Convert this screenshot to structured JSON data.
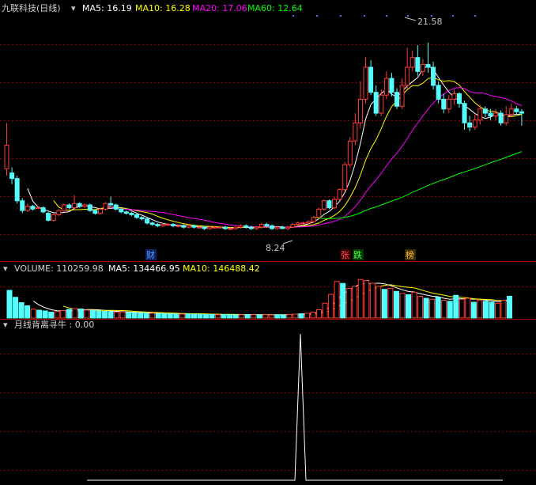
{
  "colors": {
    "background": "#000000",
    "up": "#ff3b3b",
    "down": "#54ffff",
    "ma5": "#ffffff",
    "ma10": "#ffff00",
    "ma20": "#ff00ff",
    "ma60": "#00ff00",
    "grid": "#8a0000",
    "text": "#c8c8c8"
  },
  "header": {
    "title": "九联科技(日线)",
    "ma5_label": "MA5: 16.19",
    "ma10_label": "MA10: 16.28",
    "ma20_label": "MA20: 17.06",
    "ma60_label": "MA60: 12.64"
  },
  "volume_header": {
    "title": "VOLUME: 110259.98",
    "ma5_label": "MA5: 134466.95",
    "ma10_label": "MA10: 146488.42"
  },
  "indicator_header": {
    "title": "月线背离寻牛 : 0.00"
  },
  "markers": {
    "cai": "财",
    "zhang": "张",
    "die": "跌",
    "bang": "榜"
  },
  "chart_data": {
    "type": "candlestick",
    "high_label": "21.58",
    "low_label": "8.24",
    "price_range": [
      7.0,
      23.5
    ],
    "candles": [
      [
        12.5,
        14.2,
        12.0,
        15.8
      ],
      [
        12.2,
        11.8,
        11.4,
        12.6
      ],
      [
        11.8,
        10.2,
        10.0,
        12.0
      ],
      [
        10.2,
        9.5,
        9.3,
        10.4
      ],
      [
        9.5,
        9.8,
        9.4,
        10.0
      ],
      [
        9.8,
        9.6,
        9.5,
        9.9
      ],
      [
        9.7,
        9.7,
        9.6,
        9.8
      ],
      [
        9.7,
        9.4,
        9.3,
        9.8
      ],
      [
        9.3,
        8.8,
        8.7,
        9.4
      ],
      [
        8.8,
        9.2,
        8.7,
        9.3
      ],
      [
        9.2,
        9.5,
        9.1,
        9.6
      ],
      [
        9.5,
        9.9,
        9.4,
        10.0
      ],
      [
        9.9,
        9.7,
        9.6,
        10.0
      ],
      [
        9.7,
        10.0,
        9.6,
        10.6
      ],
      [
        10.0,
        9.8,
        9.7,
        10.1
      ],
      [
        9.8,
        9.9,
        9.7,
        10.0
      ],
      [
        9.9,
        9.5,
        9.4,
        10.0
      ],
      [
        9.5,
        9.3,
        9.2,
        9.6
      ],
      [
        9.3,
        9.6,
        9.2,
        9.7
      ],
      [
        9.6,
        10.0,
        9.5,
        10.1
      ],
      [
        10.0,
        9.9,
        9.8,
        10.5
      ],
      [
        9.9,
        9.6,
        9.5,
        10.0
      ],
      [
        9.6,
        9.4,
        9.3,
        9.7
      ],
      [
        9.4,
        9.3,
        9.2,
        9.5
      ],
      [
        9.3,
        9.2,
        9.1,
        9.4
      ],
      [
        9.2,
        9.0,
        8.9,
        9.3
      ],
      [
        9.0,
        8.9,
        8.8,
        9.1
      ],
      [
        8.9,
        8.6,
        8.5,
        9.0
      ],
      [
        8.6,
        8.5,
        8.4,
        8.7
      ],
      [
        8.5,
        8.4,
        8.3,
        8.6
      ],
      [
        8.4,
        8.5,
        8.3,
        8.6
      ],
      [
        8.5,
        8.5,
        8.4,
        8.6
      ],
      [
        8.5,
        8.4,
        8.3,
        8.6
      ],
      [
        8.4,
        8.4,
        8.3,
        8.5
      ],
      [
        8.4,
        8.3,
        8.2,
        8.5
      ],
      [
        8.3,
        8.4,
        8.2,
        8.5
      ],
      [
        8.4,
        8.3,
        8.2,
        8.5
      ],
      [
        8.3,
        8.3,
        8.2,
        8.4
      ],
      [
        8.3,
        8.2,
        8.1,
        8.4
      ],
      [
        8.2,
        8.3,
        8.1,
        8.4
      ],
      [
        8.3,
        8.3,
        8.2,
        8.4
      ],
      [
        8.3,
        8.3,
        8.2,
        8.4
      ],
      [
        8.3,
        8.2,
        8.1,
        8.4
      ],
      [
        8.2,
        8.2,
        8.1,
        8.3
      ],
      [
        8.2,
        8.3,
        8.1,
        8.4
      ],
      [
        8.3,
        8.4,
        8.2,
        8.5
      ],
      [
        8.4,
        8.3,
        8.2,
        8.5
      ],
      [
        8.3,
        8.2,
        8.1,
        8.4
      ],
      [
        8.2,
        8.3,
        8.1,
        8.4
      ],
      [
        8.3,
        8.5,
        8.2,
        8.6
      ],
      [
        8.5,
        8.4,
        8.3,
        8.6
      ],
      [
        8.4,
        8.2,
        8.1,
        8.5
      ],
      [
        8.2,
        8.3,
        8.1,
        8.4
      ],
      [
        8.3,
        8.2,
        8.2,
        8.4
      ],
      [
        8.2,
        8.3,
        8.1,
        8.4
      ],
      [
        8.3,
        8.5,
        8.24,
        8.6
      ],
      [
        8.5,
        8.6,
        8.4,
        8.7
      ],
      [
        8.6,
        8.6,
        8.4,
        8.7
      ],
      [
        8.6,
        8.7,
        8.5,
        8.8
      ],
      [
        8.7,
        9.0,
        8.6,
        9.1
      ],
      [
        9.0,
        9.6,
        8.9,
        9.7
      ],
      [
        9.6,
        10.2,
        9.5,
        10.3
      ],
      [
        10.2,
        9.7,
        9.6,
        10.3
      ],
      [
        9.7,
        10.3,
        9.6,
        10.5
      ],
      [
        10.3,
        11.0,
        10.2,
        11.1
      ],
      [
        11.0,
        12.8,
        10.9,
        13.0
      ],
      [
        12.8,
        14.5,
        12.6,
        14.8
      ],
      [
        14.5,
        15.8,
        14.2,
        16.5
      ],
      [
        15.8,
        17.5,
        15.4,
        18.8
      ],
      [
        17.5,
        19.8,
        17.2,
        20.5
      ],
      [
        19.8,
        18.0,
        17.8,
        20.3
      ],
      [
        18.0,
        16.5,
        16.3,
        18.5
      ],
      [
        16.5,
        17.8,
        16.3,
        18.2
      ],
      [
        17.8,
        19.0,
        17.5,
        19.5
      ],
      [
        19.0,
        18.0,
        17.7,
        19.4
      ],
      [
        18.0,
        17.0,
        16.8,
        18.3
      ],
      [
        17.0,
        18.5,
        16.8,
        19.0
      ],
      [
        18.5,
        19.8,
        18.2,
        21.2
      ],
      [
        19.8,
        20.5,
        19.5,
        21.0
      ],
      [
        20.5,
        19.5,
        19.2,
        21.4
      ],
      [
        19.5,
        20.0,
        19.2,
        20.4
      ],
      [
        20.0,
        19.8,
        19.4,
        21.58
      ],
      [
        19.8,
        18.5,
        18.2,
        20.2
      ],
      [
        18.5,
        17.5,
        17.2,
        18.8
      ],
      [
        17.5,
        16.8,
        16.5,
        17.9
      ],
      [
        16.8,
        17.5,
        16.5,
        17.8
      ],
      [
        17.5,
        17.9,
        17.1,
        18.2
      ],
      [
        17.9,
        17.2,
        16.9,
        18.0
      ],
      [
        17.2,
        15.8,
        15.3,
        17.4
      ],
      [
        15.8,
        15.5,
        15.2,
        16.3
      ],
      [
        15.5,
        16.0,
        15.3,
        16.4
      ],
      [
        16.0,
        16.8,
        15.7,
        17.1
      ],
      [
        16.8,
        16.5,
        16.2,
        17.0
      ],
      [
        16.5,
        16.3,
        16.0,
        16.8
      ],
      [
        16.3,
        16.5,
        16.0,
        16.8
      ],
      [
        16.5,
        15.8,
        15.6,
        16.7
      ],
      [
        15.8,
        16.4,
        15.6,
        17.0
      ],
      [
        16.4,
        16.8,
        16.2,
        17.2
      ],
      [
        16.8,
        16.6,
        16.4,
        17.0
      ],
      [
        16.6,
        16.5,
        15.6,
        16.8
      ]
    ],
    "volume": [
      [
        140000,
        "down"
      ],
      [
        105000,
        "down"
      ],
      [
        78000,
        "down"
      ],
      [
        62000,
        "down"
      ],
      [
        45000,
        "up"
      ],
      [
        40000,
        "down"
      ],
      [
        36000,
        "down"
      ],
      [
        30000,
        "down"
      ],
      [
        33000,
        "up"
      ],
      [
        38000,
        "up"
      ],
      [
        44000,
        "down"
      ],
      [
        48000,
        "up"
      ],
      [
        46000,
        "down"
      ],
      [
        40000,
        "up"
      ],
      [
        38000,
        "down"
      ],
      [
        36000,
        "down"
      ],
      [
        34000,
        "down"
      ],
      [
        32000,
        "down"
      ],
      [
        30000,
        "up"
      ],
      [
        31000,
        "up"
      ],
      [
        28000,
        "down"
      ],
      [
        26000,
        "down"
      ],
      [
        25000,
        "down"
      ],
      [
        25000,
        "down"
      ],
      [
        24000,
        "up"
      ],
      [
        22000,
        "down"
      ],
      [
        22000,
        "down"
      ],
      [
        21000,
        "down"
      ],
      [
        20000,
        "down"
      ],
      [
        20000,
        "up"
      ],
      [
        21000,
        "down"
      ],
      [
        20000,
        "down"
      ],
      [
        19000,
        "down"
      ],
      [
        18000,
        "down"
      ],
      [
        18000,
        "down"
      ],
      [
        17000,
        "up"
      ],
      [
        18000,
        "down"
      ],
      [
        17000,
        "down"
      ],
      [
        16000,
        "down"
      ],
      [
        17000,
        "up"
      ],
      [
        18000,
        "down"
      ],
      [
        17000,
        "up"
      ],
      [
        16000,
        "down"
      ],
      [
        17000,
        "up"
      ],
      [
        16000,
        "up"
      ],
      [
        17000,
        "down"
      ],
      [
        16000,
        "down"
      ],
      [
        18000,
        "up"
      ],
      [
        20000,
        "up"
      ],
      [
        22000,
        "down"
      ],
      [
        24000,
        "up"
      ],
      [
        30000,
        "up"
      ],
      [
        42000,
        "up"
      ],
      [
        75000,
        "up"
      ],
      [
        120000,
        "up"
      ],
      [
        185000,
        "up"
      ],
      [
        175000,
        "down"
      ],
      [
        150000,
        "up"
      ],
      [
        160000,
        "up"
      ],
      [
        195000,
        "up"
      ],
      [
        190000,
        "up"
      ],
      [
        176000,
        "up"
      ],
      [
        160000,
        "up"
      ],
      [
        145000,
        "down"
      ],
      [
        150000,
        "up"
      ],
      [
        135000,
        "down"
      ],
      [
        125000,
        "up"
      ],
      [
        118000,
        "down"
      ],
      [
        130000,
        "up"
      ],
      [
        110000,
        "up"
      ],
      [
        100000,
        "down"
      ],
      [
        95000,
        "up"
      ],
      [
        105000,
        "down"
      ],
      [
        90000,
        "up"
      ],
      [
        85000,
        "down"
      ],
      [
        115000,
        "down"
      ],
      [
        95000,
        "up"
      ],
      [
        100000,
        "up"
      ],
      [
        80000,
        "down"
      ],
      [
        90000,
        "up"
      ],
      [
        85000,
        "down"
      ],
      [
        80000,
        "down"
      ],
      [
        75000,
        "up"
      ],
      [
        90000,
        "up"
      ],
      [
        110259.98,
        "down"
      ]
    ],
    "vol_range": [
      0,
      200000
    ],
    "indicator_spike": {
      "value": 1.0,
      "baseline": 0.0,
      "center_index": 62
    }
  }
}
